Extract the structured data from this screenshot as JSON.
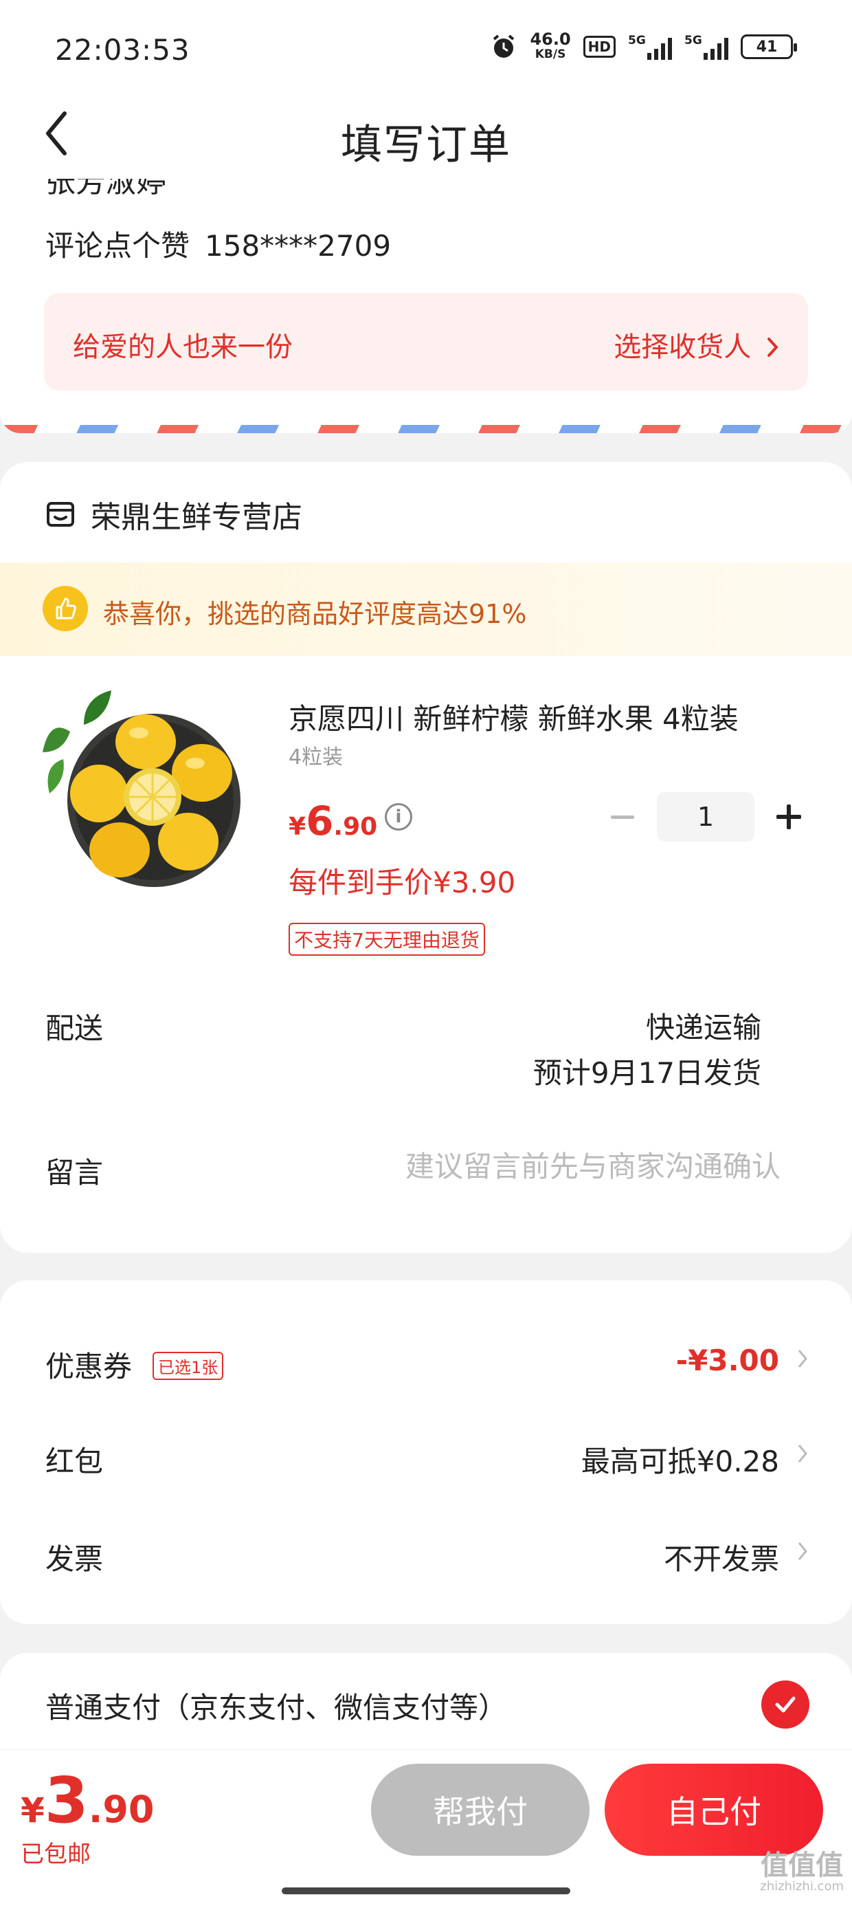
{
  "status_bar": {
    "time": "22:03:53",
    "net_speed": "46.0",
    "net_unit": "KB/S",
    "hd_label": "HD",
    "signal_1": "5G",
    "signal_2": "5G",
    "battery": "41"
  },
  "header": {
    "title": "填写订单"
  },
  "address": {
    "name_cut": "张芳淑婷",
    "contact_name": "评论点个赞",
    "phone": "158****2709",
    "gift_text": "给爱的人也来一份",
    "gift_action": "选择收货人"
  },
  "shop": {
    "name": "荣鼎生鲜专营店",
    "rating_banner": "恭喜你，挑选的商品好评度高达91%",
    "product": {
      "title": "京愿四川 新鲜柠檬 新鲜水果 4粒装",
      "spec": "4粒装",
      "price_currency": "¥",
      "price_int": "6",
      "price_dec": ".90",
      "info_icon": "i",
      "quantity": "1",
      "unit_price_label": "每件到手价¥3.90",
      "return_tag": "不支持7天无理由退货"
    },
    "delivery": {
      "label": "配送",
      "method": "快递运输",
      "estimate": "预计9月17日发货"
    },
    "note": {
      "label": "留言",
      "placeholder": "建议留言前先与商家沟通确认"
    }
  },
  "promotions": {
    "coupon": {
      "label": "优惠券",
      "tag": "已选1张",
      "value": "-¥3.00"
    },
    "red_packet": {
      "label": "红包",
      "value": "最高可抵¥0.28"
    },
    "invoice": {
      "label": "发票",
      "value": "不开发票"
    }
  },
  "payment": {
    "label": "普通支付（京东支付、微信支付等）"
  },
  "bottom_bar": {
    "total_currency": "¥",
    "total_int": "3",
    "total_dec": ".90",
    "shipping": "已包邮",
    "help_pay": "帮我付",
    "self_pay": "自己付"
  },
  "watermark": {
    "text": "值值值",
    "url": "zhizhizhi.com"
  },
  "colors": {
    "accent_red": "#e0302a",
    "button_gray": "#bdbdbd",
    "rating_orange": "#c8591a",
    "thumb_yellow": "#f7c21b"
  }
}
